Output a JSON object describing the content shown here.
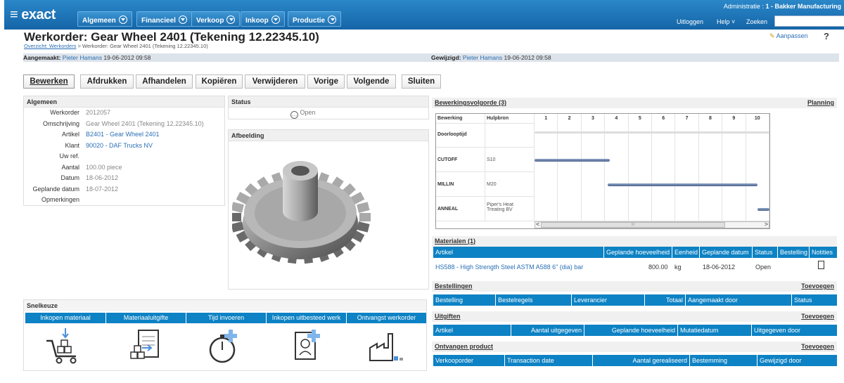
{
  "app": {
    "logo": "≡ exact"
  },
  "menu": [
    {
      "label": "Algemeen"
    },
    {
      "label": "Financieel"
    },
    {
      "label": "Verkoop"
    },
    {
      "label": "Inkoop"
    },
    {
      "label": "Productie"
    }
  ],
  "admin": {
    "label": "Administratie :",
    "value": "1 - Bakker Manufacturing"
  },
  "toplinks": {
    "logout": "Uitloggen",
    "help": "Help",
    "search": "Zoeken"
  },
  "page": {
    "title": "Werkorder: Gear Wheel 2401 (Tekening 12.22345.10)",
    "breadcrumb_link": "Overzicht: Werkorders",
    "breadcrumb_rest": "> Werkorder: Gear Wheel 2401 (Tekening 12.22345.10)",
    "customize": "Aanpassen",
    "help": "?"
  },
  "meta": {
    "created_label": "Aangemaakt:",
    "created_by": "Pieter Hamans",
    "created_date": "19-06-2012 09:58",
    "modified_label": "Gewijzigd:",
    "modified_by": "Pieter Hamans",
    "modified_date": "19-06-2012 09:58"
  },
  "actions": [
    "Bewerken",
    "Afdrukken",
    "Afhandelen",
    "Kopiëren",
    "Verwijderen",
    "Vorige",
    "Volgende",
    "Sluiten"
  ],
  "general": {
    "title": "Algemeen",
    "fields": [
      {
        "label": "Werkorder",
        "value": "2012057"
      },
      {
        "label": "Omschrijving",
        "value": "Gear Wheel 2401 (Tekening 12.22345.10)"
      },
      {
        "label": "Artikel",
        "value": "B2401 - Gear Wheel 2401"
      },
      {
        "label": "Klant",
        "value": "90020 - DAF Trucks NV"
      },
      {
        "label": "Uw ref.",
        "value": ""
      },
      {
        "label": "Aantal",
        "value": "100.00 piece"
      },
      {
        "label": "Datum",
        "value": "18-06-2012"
      },
      {
        "label": "Geplande datum",
        "value": "18-07-2012"
      },
      {
        "label": "Opmerkingen",
        "value": ""
      }
    ]
  },
  "status": {
    "title": "Status",
    "value": "Open"
  },
  "image": {
    "title": "Afbeelding"
  },
  "routing": {
    "title": "Bewerkingsvolgorde (3)",
    "link": "Planning",
    "col_operation": "Bewerking",
    "col_resource": "Hulpbron",
    "periods": [
      "1",
      "2",
      "3",
      "4",
      "5",
      "6",
      "7",
      "8",
      "9",
      "10"
    ],
    "rows": [
      {
        "operation": "Doorlooptijd",
        "resource": "",
        "start": 1,
        "end": 11
      },
      {
        "operation": "CUTOFF",
        "resource": "S10",
        "start": 1,
        "end": 4.2
      },
      {
        "operation": "MILLIN",
        "resource": "M20",
        "start": 4.1,
        "end": 10.5
      },
      {
        "operation": "ANNEAL",
        "resource": "Piper's Heat Treating BV",
        "start": 10.5,
        "end": 11
      }
    ],
    "scroll_mid": "III"
  },
  "materials": {
    "title": "Materialen (1)",
    "columns": [
      "Artikel",
      "Geplande hoeveelheid",
      "Eenheid",
      "Geplande datum",
      "Status",
      "Bestelling",
      "Notities"
    ],
    "row": {
      "article": "HS588 - High Strength Steel ASTM A588 6\" (dia) bar",
      "qty": "800.00",
      "unit": "kg",
      "date": "18-06-2012",
      "status": "Open"
    }
  },
  "orders": {
    "title": "Bestellingen",
    "link": "Toevoegen",
    "columns": [
      "Bestelling",
      "Bestelregels",
      "Leverancier",
      "Totaal",
      "Aangemaakt door",
      "Status"
    ]
  },
  "issues": {
    "title": "Uitgiften",
    "link": "Toevoegen",
    "columns": [
      "Artikel",
      "Aantal uitgegeven",
      "Geplande hoeveelheid",
      "Mutatiedatum",
      "Uitgegeven door"
    ]
  },
  "received": {
    "title": "Ontvangen product",
    "link": "Toevoegen",
    "columns": [
      "Verkooporder",
      "Transaction date",
      "Aantal gerealiseerd",
      "Bestemming",
      "Gewijzigd door"
    ]
  },
  "quick": {
    "title": "Snelkeuze",
    "items": [
      {
        "label": "Inkopen materiaal",
        "icon": "shopping-cart-icon"
      },
      {
        "label": "Materiaaluitgifte",
        "icon": "material-issue-icon"
      },
      {
        "label": "Tijd invoeren",
        "icon": "stopwatch-icon"
      },
      {
        "label": "Inkopen uitbesteed werk",
        "icon": "outsourced-work-icon"
      },
      {
        "label": "Ontvangst werkorder",
        "icon": "factory-icon"
      }
    ]
  },
  "colors": {
    "brand_blue": "#1a74b8",
    "table_header": "#0d82c4",
    "link": "#2a6fb5"
  }
}
